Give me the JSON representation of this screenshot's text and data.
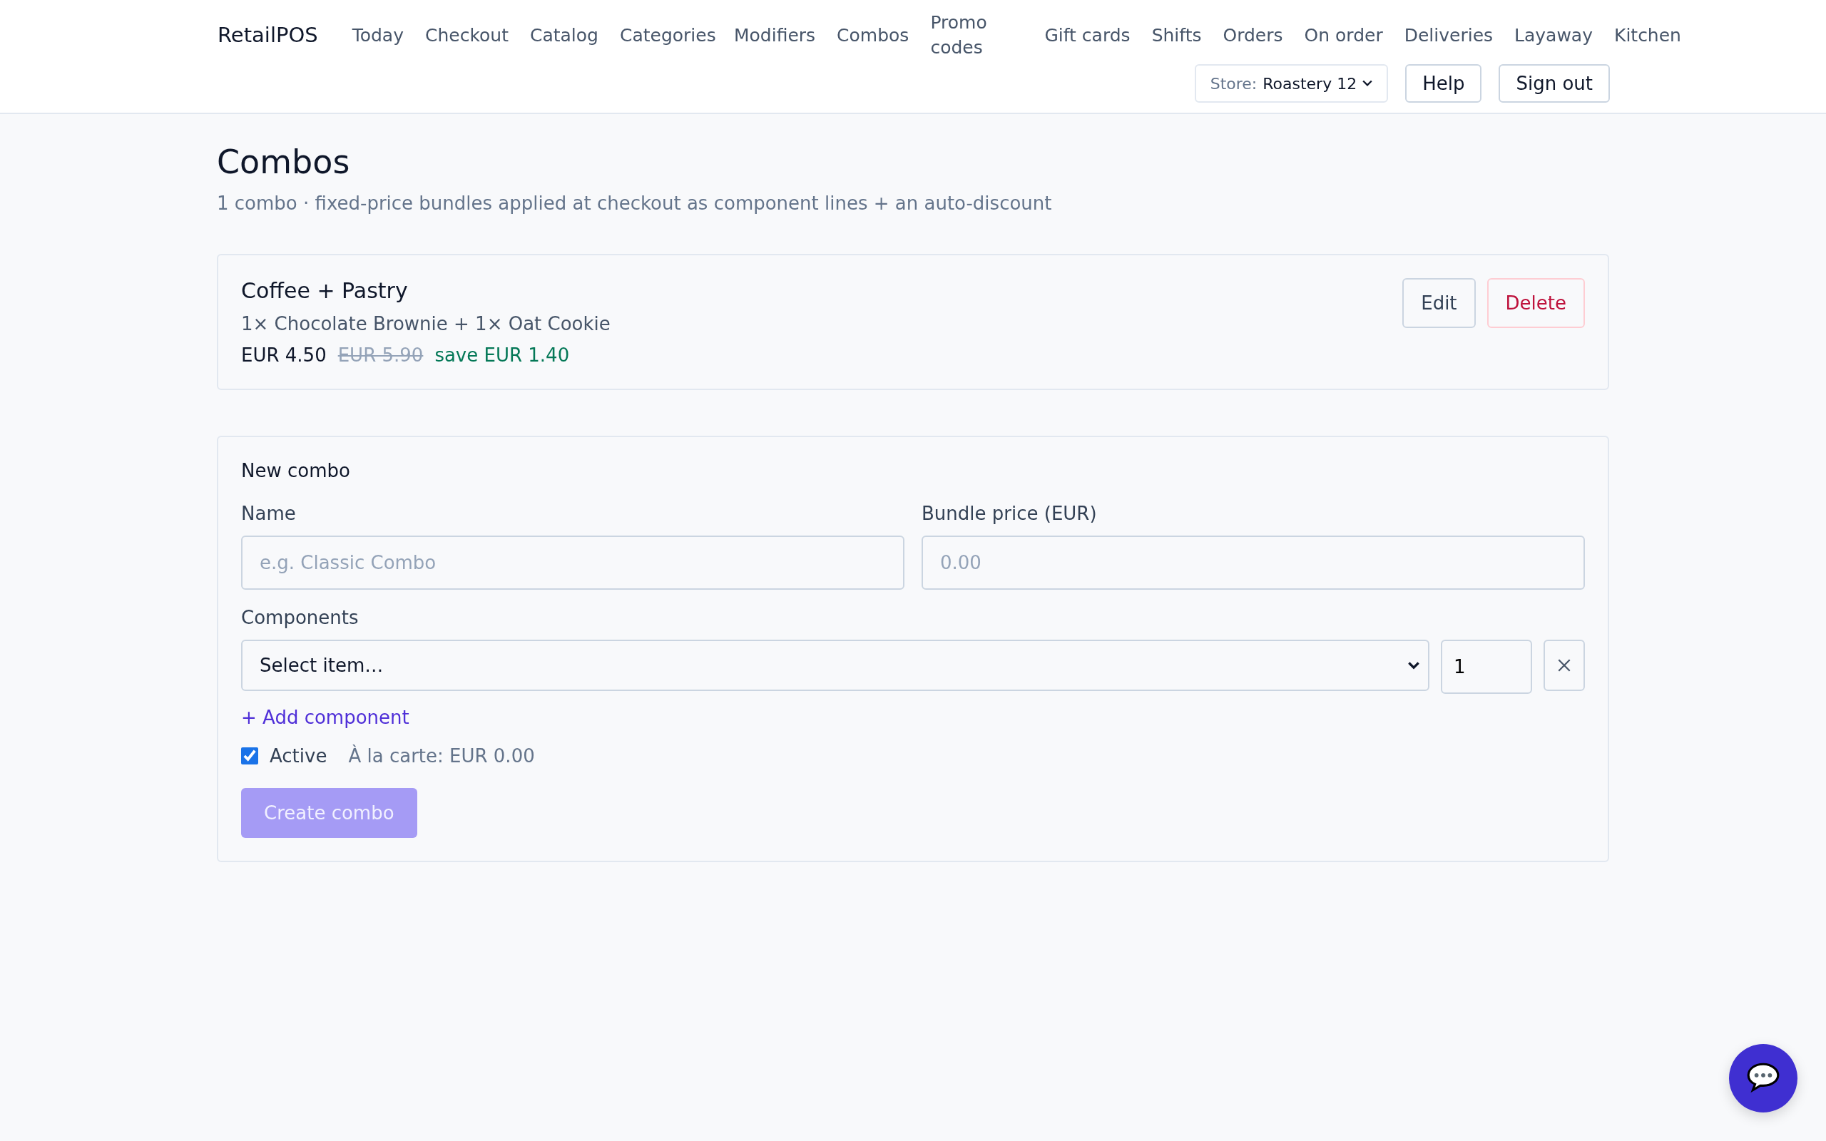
{
  "header": {
    "brand": "RetailPOS",
    "nav": [
      {
        "label": "Today"
      },
      {
        "label": "Checkout"
      },
      {
        "label": "Catalog"
      },
      {
        "label": "Categories"
      },
      {
        "label": "Modifiers"
      },
      {
        "label": "Combos"
      },
      {
        "label": "Promo codes"
      },
      {
        "label": "Gift cards"
      },
      {
        "label": "Shifts"
      },
      {
        "label": "Orders"
      },
      {
        "label": "On order"
      },
      {
        "label": "Deliveries"
      },
      {
        "label": "Layaway"
      },
      {
        "label": "Kitchen"
      }
    ],
    "store": {
      "label": "Store:",
      "value": "Roastery 12"
    },
    "buttons": [
      "Help",
      "Sign out"
    ]
  },
  "page": {
    "title": "Combos",
    "subtitle": "1 combo · fixed-price bundles applied at checkout as component lines + an auto-discount"
  },
  "combos": [
    {
      "name": "Coffee + Pastry",
      "components": "1× Chocolate Brownie + 1× Oat Cookie",
      "price": "EUR 4.50",
      "original_price": "EUR 5.90",
      "savings": "save EUR 1.40",
      "actions": [
        "Edit",
        "Delete"
      ]
    }
  ],
  "form": {
    "title": "New combo",
    "name_field": {
      "label": "Name",
      "placeholder": "e.g. Classic Combo"
    },
    "price_field": {
      "label": "Bundle price (EUR)",
      "placeholder": "0.00"
    },
    "components_label": "Components",
    "components": [
      {
        "value": "Select item…",
        "quantity": "1"
      }
    ],
    "add_label": "+ Add component",
    "active": {
      "label": "Active",
      "checked": true
    },
    "a_la_carte": "À la carte: EUR 0.00",
    "submit": {
      "label": "Create combo",
      "disabled": true
    }
  }
}
